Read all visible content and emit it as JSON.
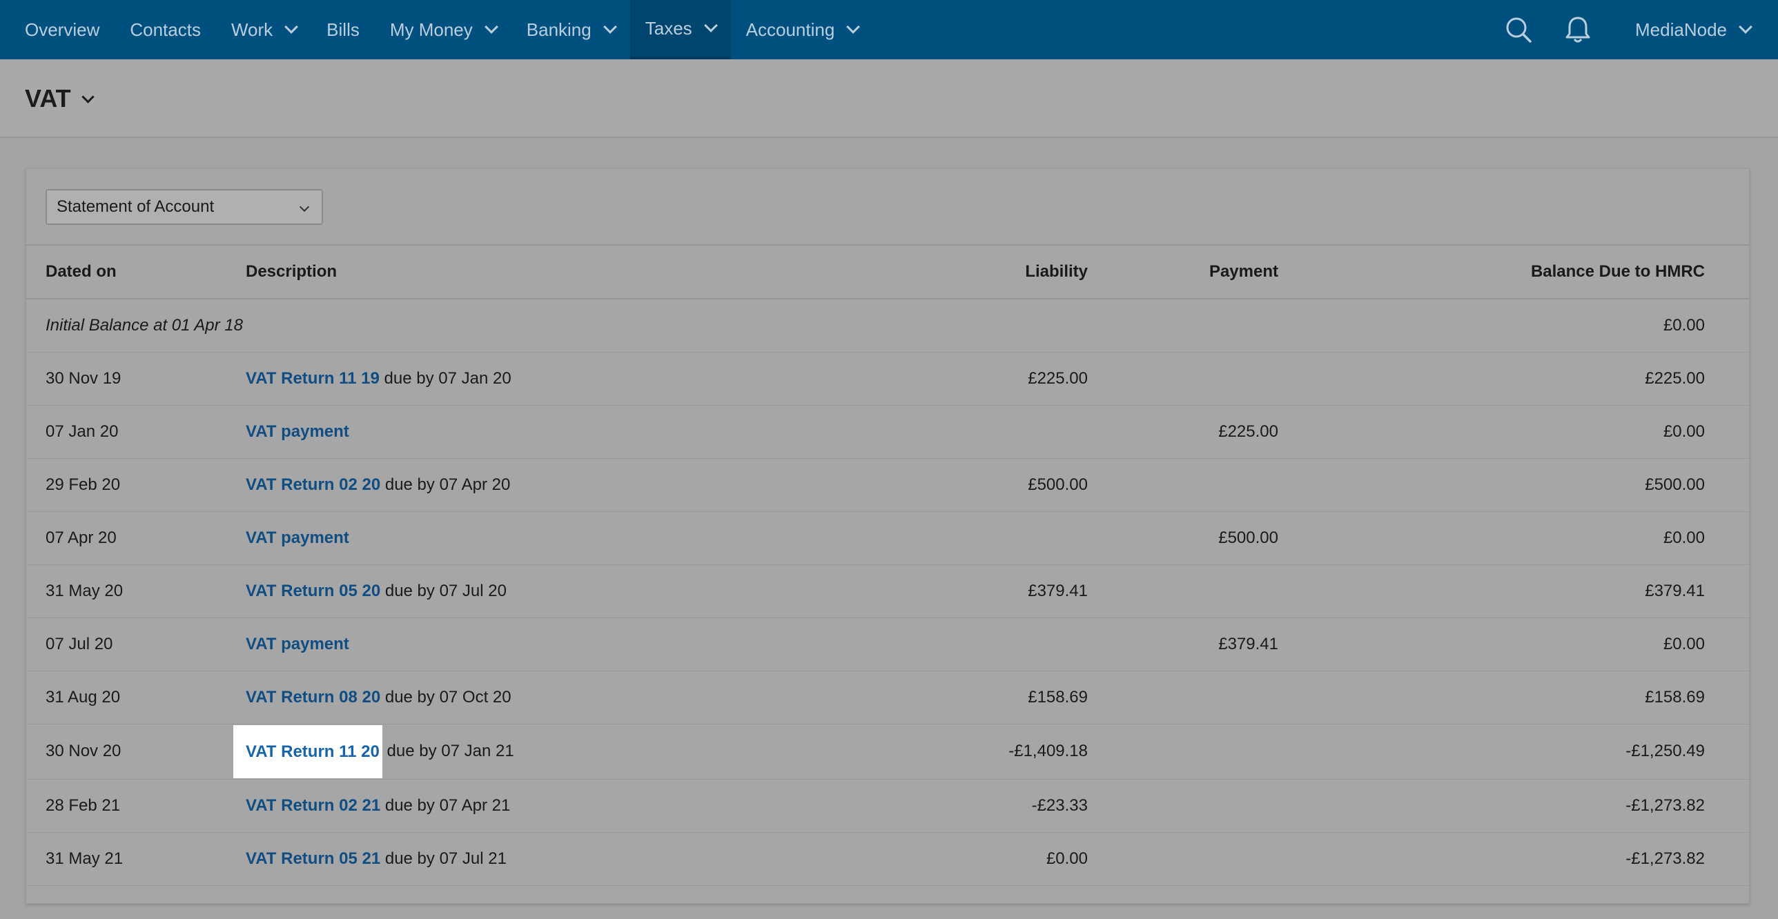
{
  "nav": {
    "items": [
      {
        "label": "Overview",
        "dropdown": false
      },
      {
        "label": "Contacts",
        "dropdown": false
      },
      {
        "label": "Work",
        "dropdown": true
      },
      {
        "label": "Bills",
        "dropdown": false
      },
      {
        "label": "My Money",
        "dropdown": true
      },
      {
        "label": "Banking",
        "dropdown": true
      },
      {
        "label": "Taxes",
        "dropdown": true,
        "active": true
      },
      {
        "label": "Accounting",
        "dropdown": true
      }
    ],
    "account": "MediaNode"
  },
  "page": {
    "title": "VAT"
  },
  "filter": {
    "selected": "Statement of Account"
  },
  "table": {
    "headers": {
      "date": "Dated on",
      "description": "Description",
      "liability": "Liability",
      "payment": "Payment",
      "balance": "Balance Due to HMRC"
    },
    "initial": {
      "label": "Initial Balance at 01 Apr 18",
      "balance": "£0.00"
    },
    "rows": [
      {
        "date": "30 Nov 19",
        "link": "VAT Return 11 19",
        "suffix": " due by 07 Jan 20",
        "liability": "£225.00",
        "payment": "",
        "balance": "£225.00"
      },
      {
        "date": "07 Jan 20",
        "link": "VAT payment",
        "suffix": "",
        "liability": "",
        "payment": "£225.00",
        "balance": "£0.00"
      },
      {
        "date": "29 Feb 20",
        "link": "VAT Return 02 20",
        "suffix": " due by 07 Apr 20",
        "liability": "£500.00",
        "payment": "",
        "balance": "£500.00"
      },
      {
        "date": "07 Apr 20",
        "link": "VAT payment",
        "suffix": "",
        "liability": "",
        "payment": "£500.00",
        "balance": "£0.00"
      },
      {
        "date": "31 May 20",
        "link": "VAT Return 05 20",
        "suffix": " due by 07 Jul 20",
        "liability": "£379.41",
        "payment": "",
        "balance": "£379.41"
      },
      {
        "date": "07 Jul 20",
        "link": "VAT payment",
        "suffix": "",
        "liability": "",
        "payment": "£379.41",
        "balance": "£0.00"
      },
      {
        "date": "31 Aug 20",
        "link": "VAT Return 08 20",
        "suffix": " due by 07 Oct 20",
        "liability": "£158.69",
        "payment": "",
        "balance": "£158.69"
      },
      {
        "date": "30 Nov 20",
        "link": "VAT Return 11 20",
        "suffix": " due by 07 Jan 21",
        "liability": "-£1,409.18",
        "payment": "",
        "balance": "-£1,250.49",
        "highlight": true
      },
      {
        "date": "28 Feb 21",
        "link": "VAT Return 02 21",
        "suffix": " due by 07 Apr 21",
        "liability": "-£23.33",
        "payment": "",
        "balance": "-£1,273.82"
      },
      {
        "date": "31 May 21",
        "link": "VAT Return 05 21",
        "suffix": " due by 07 Jul 21",
        "liability": "£0.00",
        "payment": "",
        "balance": "-£1,273.82"
      }
    ]
  },
  "colors": {
    "nav_bg": "#00507f",
    "link": "#0f4d82",
    "overlay_bg": "#a4a4a4"
  }
}
